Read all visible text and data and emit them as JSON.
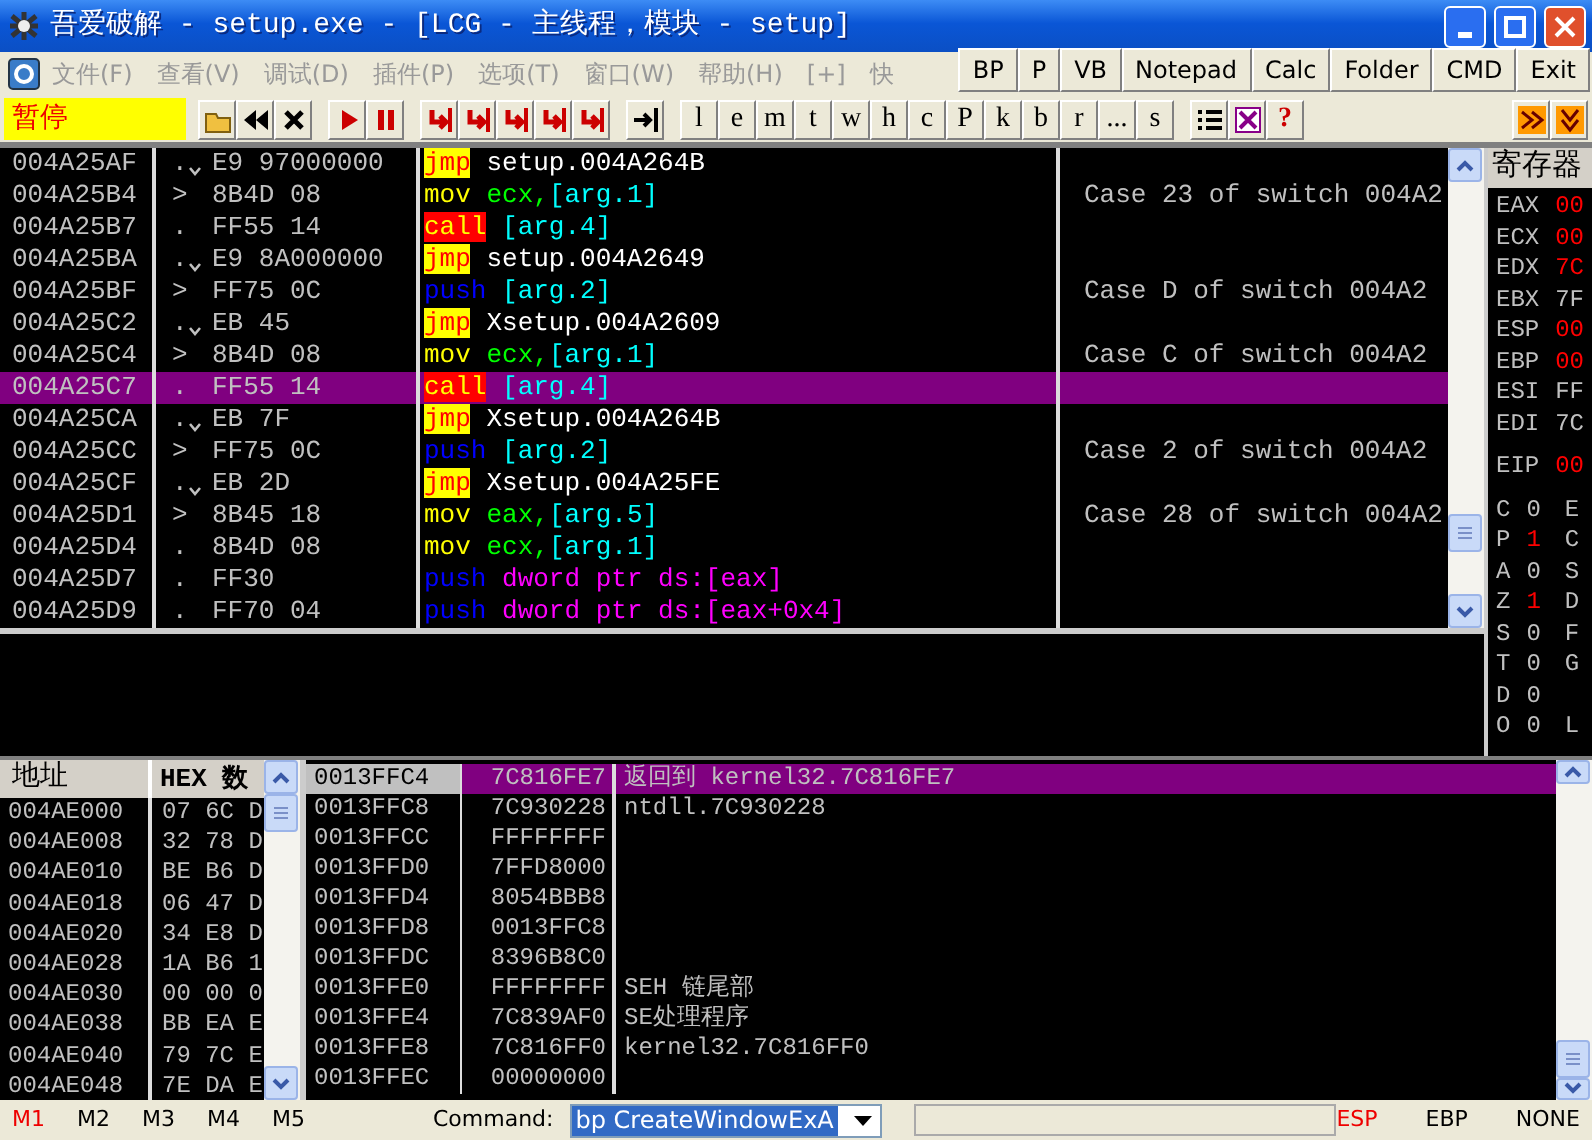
{
  "window": {
    "title": "吾爱破解 - setup.exe - [LCG - 主线程，模块 - setup]"
  },
  "menu": [
    {
      "label": "文件(F)"
    },
    {
      "label": "查看(V)"
    },
    {
      "label": "调试(D)"
    },
    {
      "label": "插件(P)"
    },
    {
      "label": "选项(T)"
    },
    {
      "label": "窗口(W)"
    },
    {
      "label": "帮助(H)"
    },
    {
      "label": "[+]"
    },
    {
      "label": "快"
    }
  ],
  "plugin_buttons": [
    "BP",
    "P",
    "VB",
    "Notepad",
    "Calc",
    "Folder",
    "CMD",
    "Exit"
  ],
  "toolbar": {
    "status": "暂停",
    "letter_buttons": [
      "l",
      "e",
      "m",
      "t",
      "w",
      "h",
      "c",
      "P",
      "k",
      "b",
      "r",
      "...",
      "s"
    ],
    "help": "?"
  },
  "disassembly": [
    {
      "address": "004A25AF",
      "marker": ".",
      "jump_down": true,
      "hex": "E9 97000000",
      "mnemonic": "jmp",
      "kind": "jump",
      "operands": [
        {
          "text": "setup.004A264B",
          "kind": "address"
        }
      ],
      "selected": false
    },
    {
      "address": "004A25B4",
      "marker": ">",
      "jump_down": false,
      "hex": "8B4D 08",
      "mnemonic": "mov",
      "kind": "move",
      "operands": [
        {
          "text": "ecx,",
          "kind": "register"
        },
        {
          "text": "[arg.1]",
          "kind": "argument"
        }
      ],
      "comment": "Case 23 of switch 004A2",
      "selected": false
    },
    {
      "address": "004A25B7",
      "marker": ".",
      "jump_down": false,
      "hex": "FF55 14",
      "mnemonic": "call",
      "kind": "call",
      "operands": [
        {
          "text": "[arg.4]",
          "kind": "argument"
        }
      ],
      "selected": false
    },
    {
      "address": "004A25BA",
      "marker": ".",
      "jump_down": true,
      "hex": "E9 8A000000",
      "mnemonic": "jmp",
      "kind": "jump",
      "operands": [
        {
          "text": "setup.004A2649",
          "kind": "address"
        }
      ],
      "selected": false
    },
    {
      "address": "004A25BF",
      "marker": ">",
      "jump_down": false,
      "hex": "FF75 0C",
      "mnemonic": "push",
      "kind": "push",
      "operands": [
        {
          "text": "[arg.2]",
          "kind": "argument"
        }
      ],
      "comment": "Case D of switch 004A2",
      "selected": false
    },
    {
      "address": "004A25C2",
      "marker": ".",
      "jump_down": true,
      "hex": "EB 45",
      "mnemonic": "jmp",
      "kind": "jump",
      "operands": [
        {
          "text": "Xsetup.004A2609",
          "kind": "address"
        }
      ],
      "selected": false
    },
    {
      "address": "004A25C4",
      "marker": ">",
      "jump_down": false,
      "hex": "8B4D 08",
      "mnemonic": "mov",
      "kind": "move",
      "operands": [
        {
          "text": "ecx,",
          "kind": "register"
        },
        {
          "text": "[arg.1]",
          "kind": "argument"
        }
      ],
      "comment": "Case C of switch 004A2",
      "selected": false
    },
    {
      "address": "004A25C7",
      "marker": ".",
      "jump_down": false,
      "hex": "FF55 14",
      "mnemonic": "call",
      "kind": "call",
      "operands": [
        {
          "text": "[arg.4]",
          "kind": "argument"
        }
      ],
      "selected": true
    },
    {
      "address": "004A25CA",
      "marker": ".",
      "jump_down": true,
      "hex": "EB 7F",
      "mnemonic": "jmp",
      "kind": "jump",
      "operands": [
        {
          "text": "Xsetup.004A264B",
          "kind": "address"
        }
      ],
      "selected": false
    },
    {
      "address": "004A25CC",
      "marker": ">",
      "jump_down": false,
      "hex": "FF75 0C",
      "mnemonic": "push",
      "kind": "push",
      "operands": [
        {
          "text": "[arg.2]",
          "kind": "argument"
        }
      ],
      "comment": "Case 2 of switch 004A2",
      "selected": false
    },
    {
      "address": "004A25CF",
      "marker": ".",
      "jump_down": true,
      "hex": "EB 2D",
      "mnemonic": "jmp",
      "kind": "jump",
      "operands": [
        {
          "text": "Xsetup.004A25FE",
          "kind": "address"
        }
      ],
      "selected": false
    },
    {
      "address": "004A25D1",
      "marker": ">",
      "jump_down": false,
      "hex": "8B45 18",
      "mnemonic": "mov",
      "kind": "move",
      "operands": [
        {
          "text": "eax,",
          "kind": "register"
        },
        {
          "text": "[arg.5]",
          "kind": "argument"
        }
      ],
      "comment": "Case 28 of switch 004A2",
      "selected": false
    },
    {
      "address": "004A25D4",
      "marker": ".",
      "jump_down": false,
      "hex": "8B4D 08",
      "mnemonic": "mov",
      "kind": "move",
      "operands": [
        {
          "text": "ecx,",
          "kind": "register"
        },
        {
          "text": "[arg.1]",
          "kind": "argument"
        }
      ],
      "selected": false
    },
    {
      "address": "004A25D7",
      "marker": ".",
      "jump_down": false,
      "hex": "FF30",
      "mnemonic": "push",
      "kind": "push",
      "operands": [
        {
          "text": "dword ptr ds:[eax]",
          "kind": "memory"
        }
      ],
      "selected": false
    },
    {
      "address": "004A25D9",
      "marker": ".",
      "jump_down": false,
      "hex": "FF70 04",
      "mnemonic": "push",
      "kind": "push",
      "operands": [
        {
          "text": "dword ptr ds:[eax+0x4]",
          "kind": "memory"
        }
      ],
      "selected": false
    }
  ],
  "registers": {
    "header": "寄存器",
    "general": [
      {
        "name": "EAX",
        "value": "00",
        "changed": true
      },
      {
        "name": "ECX",
        "value": "00",
        "changed": true
      },
      {
        "name": "EDX",
        "value": "7C",
        "changed": true
      },
      {
        "name": "EBX",
        "value": "7F",
        "changed": false
      },
      {
        "name": "ESP",
        "value": "00",
        "changed": true
      },
      {
        "name": "EBP",
        "value": "00",
        "changed": true
      },
      {
        "name": "ESI",
        "value": "FF",
        "changed": false
      },
      {
        "name": "EDI",
        "value": "7C",
        "changed": false
      }
    ],
    "instruction_pointer": {
      "name": "EIP",
      "value": "00",
      "changed": true
    },
    "flags": [
      {
        "name": "C",
        "value": "0",
        "changed": false,
        "segment": "E"
      },
      {
        "name": "P",
        "value": "1",
        "changed": true,
        "segment": "C"
      },
      {
        "name": "A",
        "value": "0",
        "changed": false,
        "segment": "S"
      },
      {
        "name": "Z",
        "value": "1",
        "changed": true,
        "segment": "D"
      },
      {
        "name": "S",
        "value": "0",
        "changed": false,
        "segment": "F"
      },
      {
        "name": "T",
        "value": "0",
        "changed": false,
        "segment": "G"
      },
      {
        "name": "D",
        "value": "0",
        "changed": false
      },
      {
        "name": "O",
        "value": "0",
        "changed": false,
        "segment": "L"
      }
    ]
  },
  "dump": {
    "columns": [
      "地址",
      "HEX 数"
    ],
    "rows": [
      {
        "address": "004AE000",
        "hex": "07 6C D"
      },
      {
        "address": "004AE008",
        "hex": "32 78 D"
      },
      {
        "address": "004AE010",
        "hex": "BE B6 D"
      },
      {
        "address": "004AE018",
        "hex": "06 47 D"
      },
      {
        "address": "004AE020",
        "hex": "34 E8 D"
      },
      {
        "address": "004AE028",
        "hex": "1A B6 1"
      },
      {
        "address": "004AE030",
        "hex": "00 00 0"
      },
      {
        "address": "004AE038",
        "hex": "BB EA E"
      },
      {
        "address": "004AE040",
        "hex": "79 7C E"
      },
      {
        "address": "004AE048",
        "hex": "7E DA E"
      }
    ]
  },
  "stack": [
    {
      "address": "0013FFC4",
      "value": "7C816FE7",
      "comment": "返回到 kernel32.7C816FE7",
      "selected": true
    },
    {
      "address": "0013FFC8",
      "value": "7C930228",
      "comment": "ntdll.7C930228",
      "selected": false
    },
    {
      "address": "0013FFCC",
      "value": "FFFFFFFF",
      "selected": false
    },
    {
      "address": "0013FFD0",
      "value": "7FFD8000",
      "selected": false
    },
    {
      "address": "0013FFD4",
      "value": "8054BBB8",
      "selected": false
    },
    {
      "address": "0013FFD8",
      "value": "0013FFC8",
      "selected": false
    },
    {
      "address": "0013FFDC",
      "value": "8396B8C0",
      "selected": false
    },
    {
      "address": "0013FFE0",
      "value": "FFFFFFFF",
      "comment": "SEH 链尾部",
      "selected": false
    },
    {
      "address": "0013FFE4",
      "value": "7C839AF0",
      "comment": "SE处理程序",
      "selected": false
    },
    {
      "address": "0013FFE8",
      "value": "7C816FF0",
      "comment": "kernel32.7C816FF0",
      "selected": false
    },
    {
      "address": "0013FFEC",
      "value": "00000000",
      "selected": false
    }
  ],
  "status_bar": {
    "memory_tabs": [
      {
        "label": "M1",
        "selected": true
      },
      {
        "label": "M2",
        "selected": false
      },
      {
        "label": "M3",
        "selected": false
      },
      {
        "label": "M4",
        "selected": false
      },
      {
        "label": "M5",
        "selected": false
      }
    ],
    "command_label": "Command:",
    "command": "bp CreateWindowExA",
    "indicators": [
      {
        "label": "ESP",
        "selected": true
      },
      {
        "label": "EBP",
        "selected": false
      },
      {
        "label": "NONE",
        "selected": false
      }
    ]
  }
}
